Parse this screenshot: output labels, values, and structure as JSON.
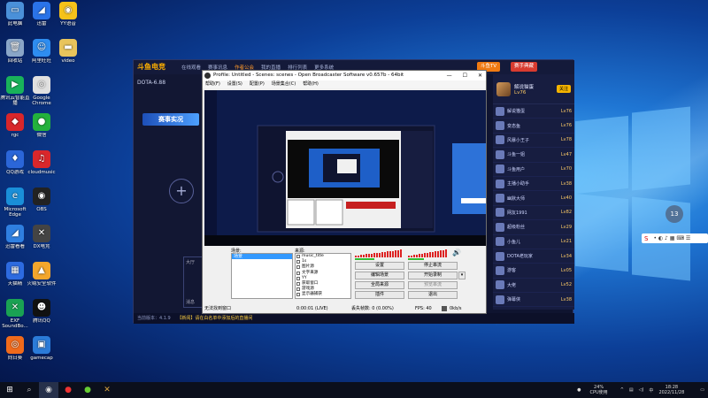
{
  "desktop_icons": [
    {
      "label": "此电脑",
      "color": "#4a90d9",
      "glyph": "▭"
    },
    {
      "label": "迅雷",
      "color": "#2a73e8",
      "glyph": "◢"
    },
    {
      "label": "YY语音",
      "color": "#f5c21a",
      "glyph": "◉"
    },
    {
      "label": "回收站",
      "color": "#8aa6c8",
      "glyph": "🗑"
    },
    {
      "label": "阿里旺旺",
      "color": "#2e8df0",
      "glyph": "☺"
    },
    {
      "label": "video",
      "color": "#e8c45c",
      "glyph": "▬"
    },
    {
      "label": "腾讯云智能直播",
      "color": "#19b25a",
      "glyph": "▶"
    },
    {
      "label": "Google Chrome",
      "color": "#e0e0e0",
      "glyph": "◎"
    },
    {
      "label": "rgc",
      "color": "#d8262b",
      "glyph": "◆"
    },
    {
      "label": "微信",
      "color": "#23b13c",
      "glyph": "●"
    },
    {
      "label": "QQ游戏",
      "color": "#2b66d8",
      "glyph": "♦"
    },
    {
      "label": "cloudmusic",
      "color": "#d9272b",
      "glyph": "♫"
    },
    {
      "label": "Microsoft Edge",
      "color": "#1a8fd8",
      "glyph": "e"
    },
    {
      "label": "OBS",
      "color": "#222222",
      "glyph": "◉"
    },
    {
      "label": "迅雷看看",
      "color": "#2f7fe0",
      "glyph": "◢"
    },
    {
      "label": "DX电竞",
      "color": "#444444",
      "glyph": "✕"
    },
    {
      "label": "天猫精",
      "color": "#2d6be0",
      "glyph": "▦"
    },
    {
      "label": "火绒安全软件",
      "color": "#f3a62c",
      "glyph": "▲"
    },
    {
      "label": "EXF SoundBo...",
      "color": "#1aa253",
      "glyph": "✕"
    },
    {
      "label": "腾讯QQ",
      "color": "#111111",
      "glyph": "☻"
    },
    {
      "label": "向日葵",
      "color": "#f06a1b",
      "glyph": "◎"
    },
    {
      "label": "gamecap",
      "color": "#2b7bd8",
      "glyph": "▣"
    }
  ],
  "live_app": {
    "logo": "斗鱼电竞",
    "nav": [
      "在线观看",
      "赛事讯息",
      "作者公会",
      "我的直播",
      "排行列表",
      "更多系统"
    ],
    "active_nav": 2,
    "badge_1": "斗鱼TV",
    "badge_2": "赛手典藏",
    "scene_select": "DOTA-6.88",
    "banner": "赛事实况",
    "plus": "+",
    "host_name": "解说猫蛋",
    "host_level": "Lv76",
    "follow": "关注",
    "left_panel_label": "大厅",
    "left_panel_label_2": "消息",
    "users": [
      {
        "name": "解说猫蛋",
        "tag": "Lv76"
      },
      {
        "name": "变态鱼",
        "tag": "Lv76"
      },
      {
        "name": "风暴小王子",
        "tag": "Lv78"
      },
      {
        "name": "斗鱼一姐",
        "tag": "Lv47"
      },
      {
        "name": "斗鱼用户",
        "tag": "Lv70"
      },
      {
        "name": "主播小助手",
        "tag": "Lv38"
      },
      {
        "name": "幽默大师",
        "tag": "Lv40"
      },
      {
        "name": "网友1991",
        "tag": "Lv82"
      },
      {
        "name": "超级粉丝",
        "tag": "Lv29"
      },
      {
        "name": "小鱼儿",
        "tag": "Lv21"
      },
      {
        "name": "DOTA老玩家",
        "tag": "Lv34"
      },
      {
        "name": "游客",
        "tag": "Lv05"
      },
      {
        "name": "大佬",
        "tag": "Lv52"
      },
      {
        "name": "弹幕侠",
        "tag": "Lv38"
      }
    ],
    "status_version": "当前版本：4.1.9",
    "status_notice": "【新闻】请在白名单中添加后的直播间"
  },
  "obs": {
    "title": "Profile: Untitled - Scenes: scenes - Open Broadcaster Software v0.657b - 64bit",
    "menu": [
      "帮助(F)",
      "设置(S)",
      "配置(P)",
      "场景集合(C)",
      "帮助(H)"
    ],
    "scenes_label": "场景:",
    "scenes": [
      "场景"
    ],
    "sources_label": "来源:",
    "sources": [
      "music_title",
      "1s",
      "图片源",
      "文字来源",
      "YY",
      "获取窗口",
      "游戏源",
      "显示器捕获"
    ],
    "buttons": {
      "settings": "设置",
      "stop_stream": "停止串流",
      "edit_scene": "编辑场景",
      "start_record": "开始录制",
      "global_sources": "全局来源",
      "plugins": "插件",
      "exit": "退出",
      "preview_stream": "预览串流"
    },
    "status": {
      "window": "无法找到窗口",
      "time": "0:00:01 (LIVE)",
      "dropped": "丢失帧数: 0 (0.00%)",
      "fps": "FPS: 40",
      "bitrate": "0kb/s"
    }
  },
  "floating_badge": "13",
  "taskbar": {
    "cpu_percent": "24%",
    "cpu_label": "CPU使用",
    "time": "18:28",
    "date": "2022/11/28"
  }
}
